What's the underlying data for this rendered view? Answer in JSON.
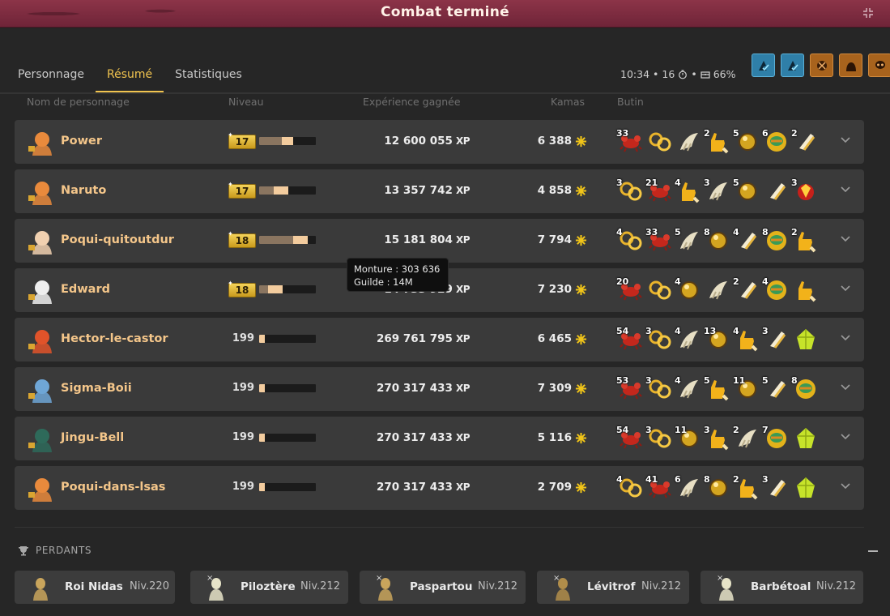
{
  "window": {
    "title": "Combat terminé"
  },
  "tabs": [
    {
      "label": "Personnage",
      "active": false
    },
    {
      "label": "Résumé",
      "active": true
    },
    {
      "label": "Statistiques",
      "active": false
    }
  ],
  "stats": {
    "time": "10:34",
    "turns": "16",
    "percent": "66%",
    "sep": "•"
  },
  "effects": [
    "blue",
    "blue",
    "orange",
    "orange",
    "orange"
  ],
  "columns": {
    "name": "Nom de personnage",
    "level": "Niveau",
    "xp": "Expérience gagnée",
    "kamas": "Kamas",
    "loot": "Butin"
  },
  "xp_unit": "XP",
  "tooltip": {
    "line1": "Monture : 303 636",
    "line2": "Guilde : 14M"
  },
  "players": [
    {
      "name": "Power",
      "level": "17",
      "level_badge": true,
      "bar_base": 0.4,
      "bar_gain": 0.2,
      "xp": "12 600 055",
      "kamas": "6 388",
      "loot": [
        [
          "crab",
          "33"
        ],
        [
          "ring",
          ""
        ],
        [
          "claw",
          ""
        ],
        [
          "hand",
          "2"
        ],
        [
          "orb",
          "5"
        ],
        [
          "medal",
          "6"
        ],
        [
          "bone",
          "2"
        ]
      ]
    },
    {
      "name": "Naruto",
      "level": "17",
      "level_badge": true,
      "bar_base": 0.25,
      "bar_gain": 0.25,
      "xp": "13 357 742",
      "kamas": "4 858",
      "loot": [
        [
          "ring",
          "3"
        ],
        [
          "crab",
          "21"
        ],
        [
          "hand",
          "4"
        ],
        [
          "claw",
          "3"
        ],
        [
          "orb",
          "5"
        ],
        [
          "bone",
          ""
        ],
        [
          "ruby",
          "3"
        ]
      ]
    },
    {
      "name": "Poqui-quitoutdur",
      "level": "18",
      "level_badge": true,
      "bar_base": 0.6,
      "bar_gain": 0.25,
      "xp": "15 181 804",
      "kamas": "7 794",
      "loot": [
        [
          "ring",
          "4"
        ],
        [
          "crab",
          "33"
        ],
        [
          "claw",
          "5"
        ],
        [
          "orb",
          "8"
        ],
        [
          "bone",
          "4"
        ],
        [
          "medal",
          "8"
        ],
        [
          "hand",
          "2"
        ]
      ]
    },
    {
      "name": "Edward",
      "level": "18",
      "level_badge": true,
      "bar_base": 0.15,
      "bar_gain": 0.25,
      "xp": "14 733 929",
      "kamas": "7 230",
      "loot": [
        [
          "crab",
          "20"
        ],
        [
          "ring",
          ""
        ],
        [
          "orb",
          "4"
        ],
        [
          "claw",
          ""
        ],
        [
          "bone",
          "2"
        ],
        [
          "medal",
          "4"
        ],
        [
          "hand",
          ""
        ]
      ]
    },
    {
      "name": "Hector-le-castor",
      "level": "199",
      "level_badge": false,
      "bar_base": 0,
      "bar_gain": 0.1,
      "xp": "269 761 795",
      "kamas": "6 465",
      "loot": [
        [
          "crab",
          "54"
        ],
        [
          "ring",
          "3"
        ],
        [
          "claw",
          "4"
        ],
        [
          "orb",
          "13"
        ],
        [
          "hand",
          "4"
        ],
        [
          "bone",
          "3"
        ],
        [
          "gem",
          ""
        ]
      ]
    },
    {
      "name": "Sigma-Boii",
      "level": "199",
      "level_badge": false,
      "bar_base": 0,
      "bar_gain": 0.1,
      "xp": "270 317 433",
      "kamas": "7 309",
      "loot": [
        [
          "crab",
          "53"
        ],
        [
          "ring",
          "3"
        ],
        [
          "claw",
          "4"
        ],
        [
          "hand",
          "5"
        ],
        [
          "orb",
          "11"
        ],
        [
          "bone",
          "5"
        ],
        [
          "medal",
          "8"
        ]
      ]
    },
    {
      "name": "Jingu-Bell",
      "level": "199",
      "level_badge": false,
      "bar_base": 0,
      "bar_gain": 0.1,
      "xp": "270 317 433",
      "kamas": "5 116",
      "loot": [
        [
          "crab",
          "54"
        ],
        [
          "ring",
          "3"
        ],
        [
          "orb",
          "11"
        ],
        [
          "hand",
          "3"
        ],
        [
          "claw",
          "2"
        ],
        [
          "medal",
          "7"
        ],
        [
          "gem",
          ""
        ]
      ]
    },
    {
      "name": "Poqui-dans-lsas",
      "level": "199",
      "level_badge": false,
      "bar_base": 0,
      "bar_gain": 0.1,
      "xp": "270 317 433",
      "kamas": "2 709",
      "loot": [
        [
          "ring",
          "4"
        ],
        [
          "crab",
          "41"
        ],
        [
          "claw",
          "6"
        ],
        [
          "orb",
          "8"
        ],
        [
          "hand",
          "2"
        ],
        [
          "bone",
          "3"
        ],
        [
          "gem",
          ""
        ]
      ]
    }
  ],
  "losers_header": "PERDANTS",
  "losers": [
    {
      "name": "Roi Nidas",
      "level": "Niv.220",
      "x": ""
    },
    {
      "name": "Piloztère",
      "level": "Niv.212",
      "x": "×"
    },
    {
      "name": "Paspartou",
      "level": "Niv.212",
      "x": "×"
    },
    {
      "name": "Lévitrof",
      "level": "Niv.212",
      "x": "×"
    },
    {
      "name": "Barbétoal",
      "level": "Niv.212",
      "x": "×"
    }
  ],
  "colors": {
    "accent": "#f1c44f",
    "row_bg": "#3a3a3a",
    "title_bar": "#7e2c40",
    "name": "#f4c68a"
  }
}
